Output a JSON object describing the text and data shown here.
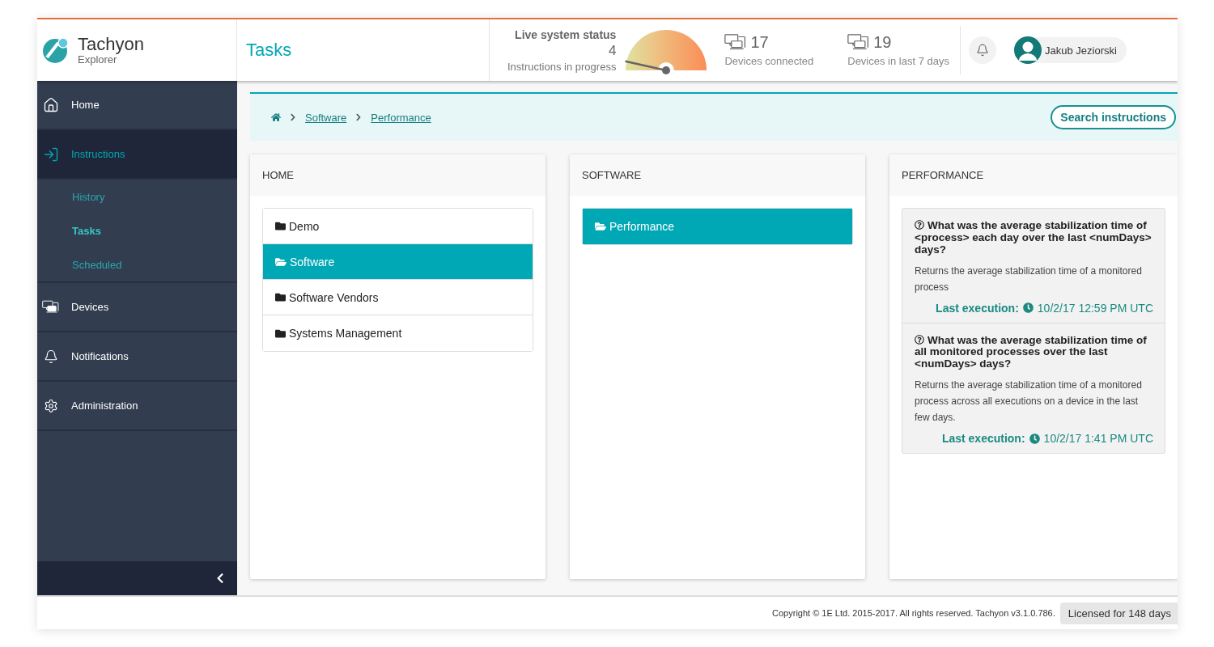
{
  "app": {
    "name": "Tachyon",
    "subtitle": "Explorer"
  },
  "page_title": "Tasks",
  "live_status": {
    "title": "Live system status",
    "count": "4",
    "caption": "Instructions in progress"
  },
  "device_stats": [
    {
      "count": "17",
      "caption": "Devices connected"
    },
    {
      "count": "19",
      "caption": "Devices in last 7 days"
    }
  ],
  "user": {
    "name": "Jakub Jeziorski"
  },
  "sidebar": {
    "items": [
      {
        "label": "Home",
        "selected": false
      },
      {
        "label": "Instructions",
        "selected": true,
        "children": [
          {
            "label": "History",
            "selected": false
          },
          {
            "label": "Tasks",
            "selected": true
          },
          {
            "label": "Scheduled",
            "selected": false
          }
        ]
      },
      {
        "label": "Devices",
        "selected": false
      },
      {
        "label": "Notifications",
        "selected": false
      },
      {
        "label": "Administration",
        "selected": false
      }
    ]
  },
  "breadcrumb": [
    "Software",
    "Performance"
  ],
  "search_button": "Search instructions",
  "columns": [
    {
      "title": "HOME",
      "kind": "folders",
      "items": [
        {
          "label": "Demo",
          "selected": false
        },
        {
          "label": "Software",
          "selected": true
        },
        {
          "label": "Software Vendors",
          "selected": false
        },
        {
          "label": "Systems Management",
          "selected": false
        }
      ]
    },
    {
      "title": "SOFTWARE",
      "kind": "folders",
      "items": [
        {
          "label": "Performance",
          "selected": true
        }
      ]
    },
    {
      "title": "PERFORMANCE",
      "kind": "instructions",
      "items": [
        {
          "question": "What was the average stabilization time of <process> each day over the last <numDays> days?",
          "description": "Returns the average stabilization time of a monitored process",
          "execution_label": "Last execution:",
          "execution_time": "10/2/17 12:59 PM UTC"
        },
        {
          "question": "What was the average stabilization time of all monitored processes over the last <numDays> days?",
          "description": "Returns the average stabilization time of a monitored process across all executions on a device in the last few days.",
          "execution_label": "Last execution:",
          "execution_time": "10/2/17 1:41 PM UTC"
        }
      ]
    }
  ],
  "footer": {
    "copyright": "Copyright © 1E Ltd. 2015-2017. All rights reserved. Tachyon v3.1.0.786.",
    "license": "Licensed for 148 days"
  }
}
